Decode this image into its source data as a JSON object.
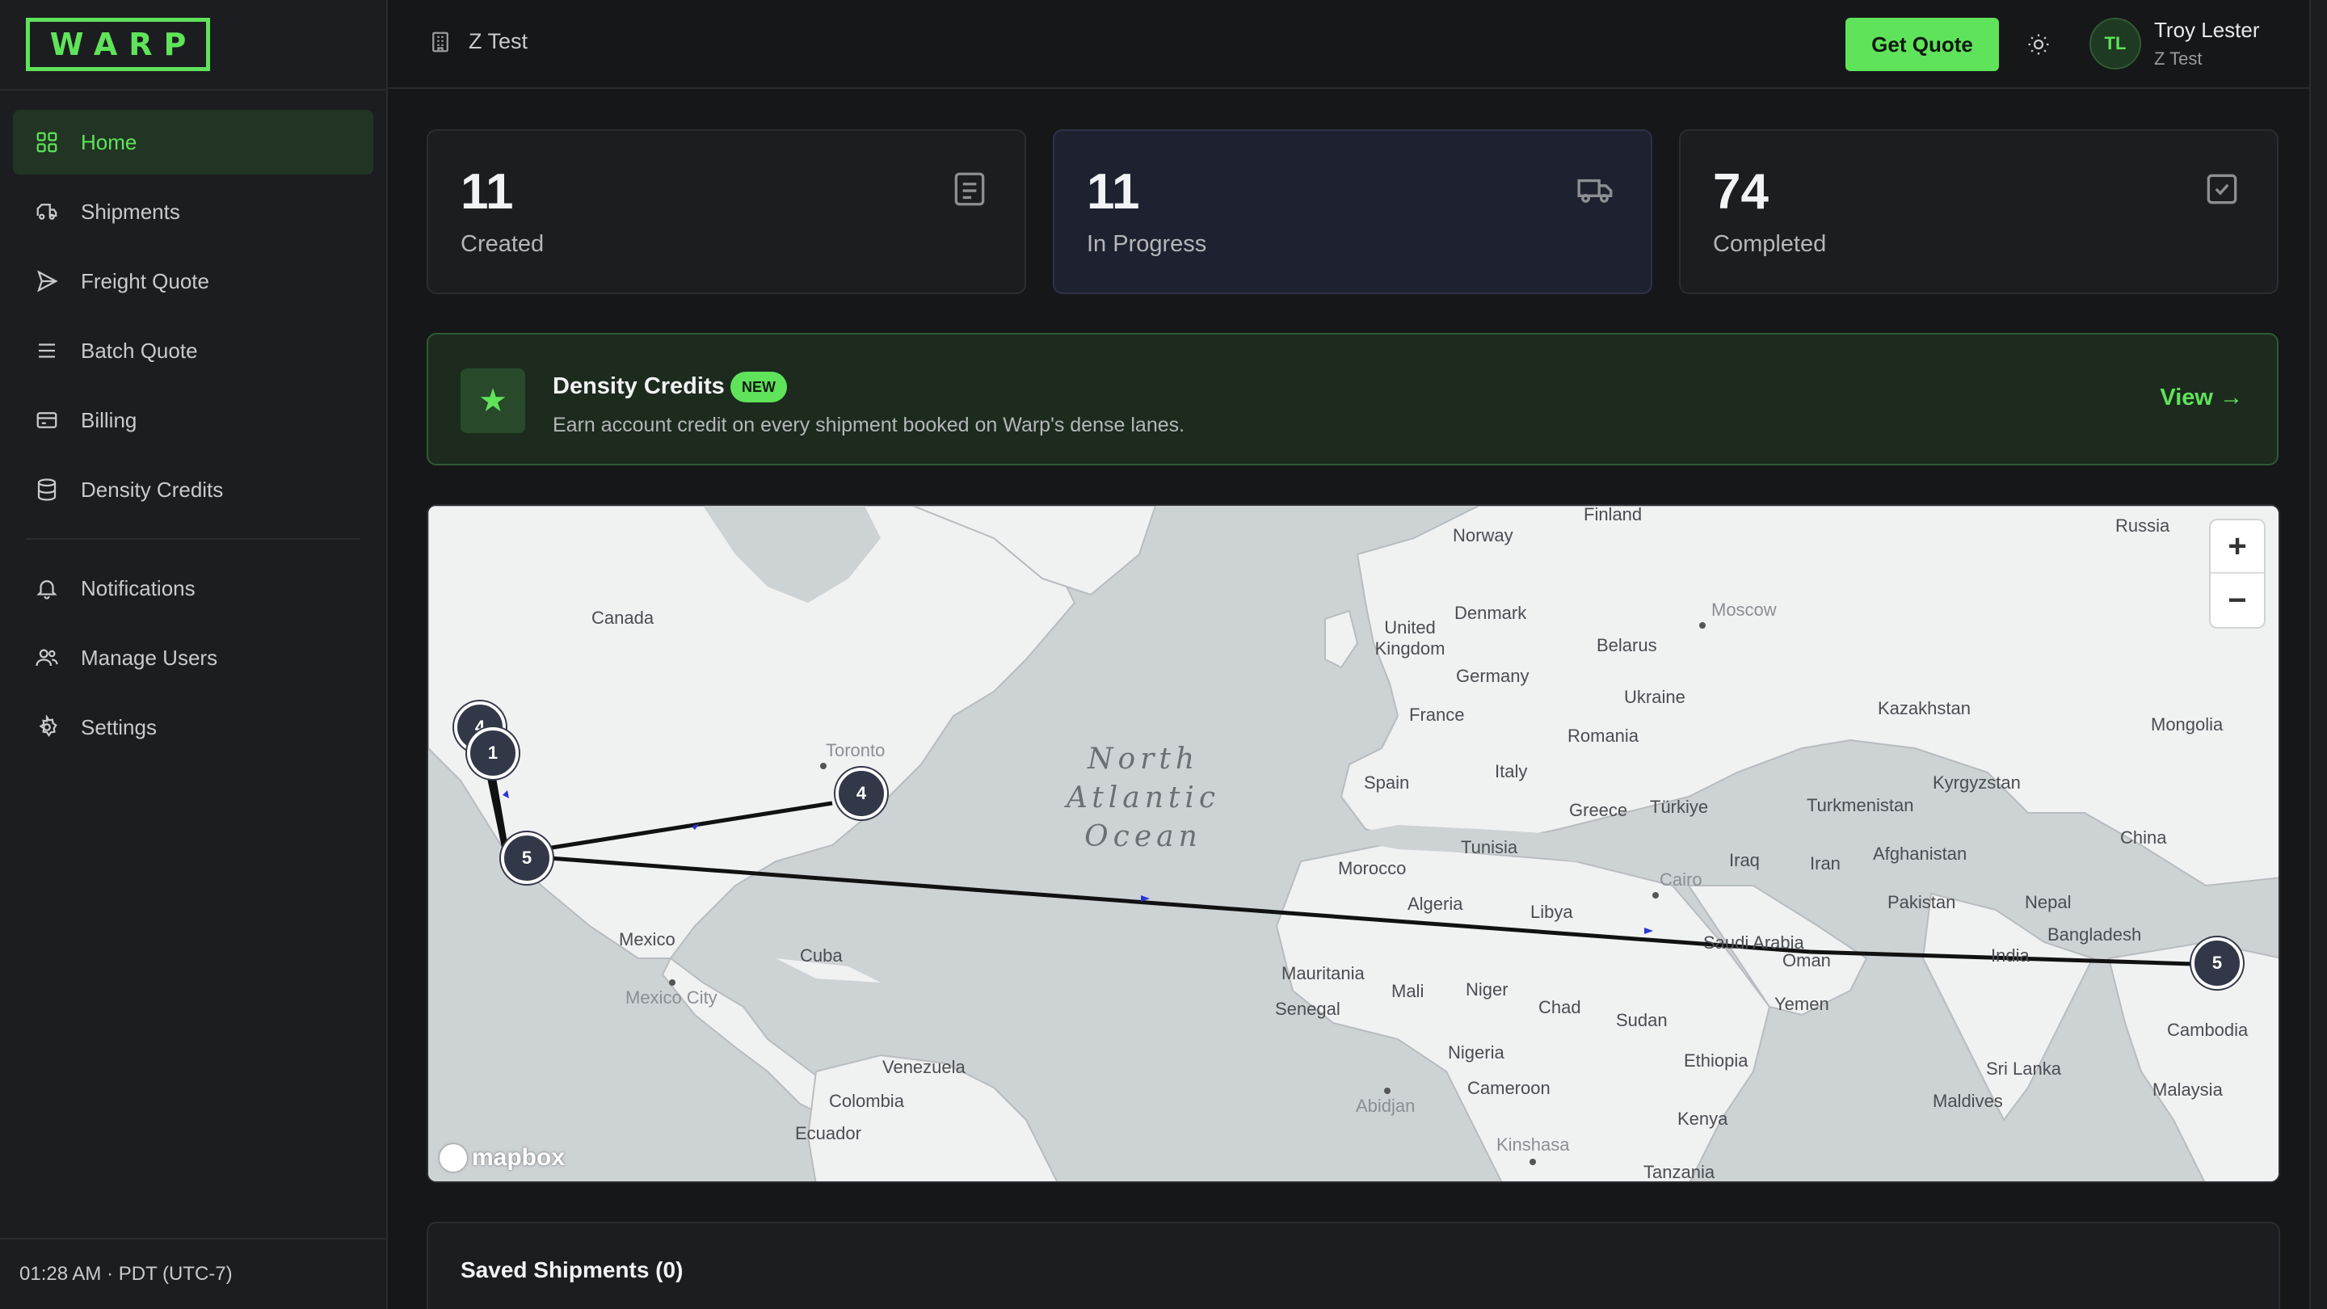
{
  "app": {
    "logo_text": "WARP"
  },
  "sidebar": {
    "items": [
      {
        "label": "Home",
        "icon": "grid-icon",
        "active": true
      },
      {
        "label": "Shipments",
        "icon": "truck-icon"
      },
      {
        "label": "Freight Quote",
        "icon": "send-icon"
      },
      {
        "label": "Batch Quote",
        "icon": "list-icon"
      },
      {
        "label": "Billing",
        "icon": "credit-card-icon"
      },
      {
        "label": "Density Credits",
        "icon": "database-icon"
      }
    ],
    "secondary_items": [
      {
        "label": "Notifications",
        "icon": "bell-icon"
      },
      {
        "label": "Manage Users",
        "icon": "users-icon"
      },
      {
        "label": "Settings",
        "icon": "gear-icon"
      }
    ],
    "clock": "01:28 AM · PDT (UTC-7)"
  },
  "header": {
    "org_name": "Z Test",
    "get_quote_label": "Get Quote",
    "user_initials": "TL",
    "user_name": "Troy Lester",
    "user_org": "Z Test"
  },
  "stats": [
    {
      "value": "11",
      "label": "Created",
      "icon": "document-icon"
    },
    {
      "value": "11",
      "label": "In Progress",
      "icon": "truck-icon"
    },
    {
      "value": "74",
      "label": "Completed",
      "icon": "check-square-icon"
    }
  ],
  "banner": {
    "title": "Density Credits",
    "badge": "NEW",
    "description": "Earn account credit on every shipment booked on Warp's dense lanes.",
    "view_label": "View →"
  },
  "map": {
    "ocean_label": "North Atlantic Ocean",
    "attribution": "mapbox",
    "zoom_in": "+",
    "zoom_out": "−",
    "labels": {
      "finland": "Finland",
      "norway": "Norway",
      "russia": "Russia",
      "canada": "Canada",
      "uk": "United Kingdom",
      "denmark": "Denmark",
      "moscow": "Moscow",
      "belarus": "Belarus",
      "germany": "Germany",
      "ukraine": "Ukraine",
      "france": "France",
      "kazakhstan": "Kazakhstan",
      "mongolia": "Mongolia",
      "romania": "Romania",
      "toronto": "Toronto",
      "spain": "Spain",
      "italy": "Italy",
      "kyrgyzstan": "Kyrgyzstan",
      "greece": "Greece",
      "turkiye": "Türkiye",
      "turkmenistan": "Turkmenistan",
      "tunisia": "Tunisia",
      "iraq": "Iraq",
      "iran": "Iran",
      "afghanistan": "Afghanistan",
      "china": "China",
      "morocco": "Morocco",
      "cairo": "Cairo",
      "algeria": "Algeria",
      "libya": "Libya",
      "pakistan": "Pakistan",
      "nepal": "Nepal",
      "mexico": "Mexico",
      "saudi": "Saudi Arabia",
      "bangladesh": "Bangladesh",
      "india": "India",
      "oman": "Oman",
      "cuba": "Cuba",
      "mauritania": "Mauritania",
      "mexico_city": "Mexico City",
      "mali": "Mali",
      "niger": "Niger",
      "chad": "Chad",
      "yemen": "Yemen",
      "senegal": "Senegal",
      "sudan": "Sudan",
      "cambodia": "Cambodia",
      "venezuela": "Venezuela",
      "ethiopia": "Ethiopia",
      "nigeria": "Nigeria",
      "sri_lanka": "Sri Lanka",
      "colombia": "Colombia",
      "cameroon": "Cameroon",
      "malaysia": "Malaysia",
      "abidjan": "Abidjan",
      "maldives": "Maldives",
      "kenya": "Kenya",
      "ecuador": "Ecuador",
      "kinshasa": "Kinshasa",
      "tanzania": "Tanzania"
    },
    "clusters": [
      {
        "count": "4"
      },
      {
        "count": "1"
      },
      {
        "count": "4"
      },
      {
        "count": "5"
      },
      {
        "count": "5"
      }
    ]
  },
  "saved_shipments": {
    "title": "Saved Shipments (0)"
  },
  "colors": {
    "accent": "#5fe35a",
    "background": "#161719",
    "sidebar": "#1c1d20",
    "cluster": "#323847"
  }
}
